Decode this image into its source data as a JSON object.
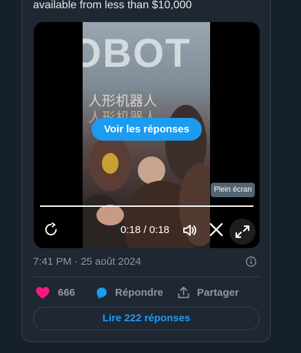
{
  "tweet": {
    "text_fragment": "available from less than $10,000"
  },
  "video": {
    "sign_text": "OBOT",
    "banner_text_1": "人形机器人",
    "banner_text_2": "人形机器人",
    "overlay_button_label": "Voir les réponses",
    "fullscreen_tooltip": "Plein écran",
    "time_display": "0:18 / 0:18",
    "progress_fraction": 1.0
  },
  "meta": {
    "timestamp": "7:41 PM · 25 août 2024"
  },
  "actions": {
    "like_count": "666",
    "reply_label": "Répondre",
    "share_label": "Partager"
  },
  "read_replies_label": "Lire 222 réponses",
  "colors": {
    "background": "#15202b",
    "card": "#1e2732",
    "accent": "#1d9bf0",
    "like": "#f91880",
    "muted": "#8b98a5",
    "border": "#38444d"
  },
  "icons": {
    "replay": "replay-icon",
    "volume": "volume-icon",
    "x_logo": "x-logo-icon",
    "fullscreen": "expand-icon",
    "info": "info-icon",
    "like": "heart-icon",
    "reply": "comment-icon",
    "share": "share-icon"
  }
}
